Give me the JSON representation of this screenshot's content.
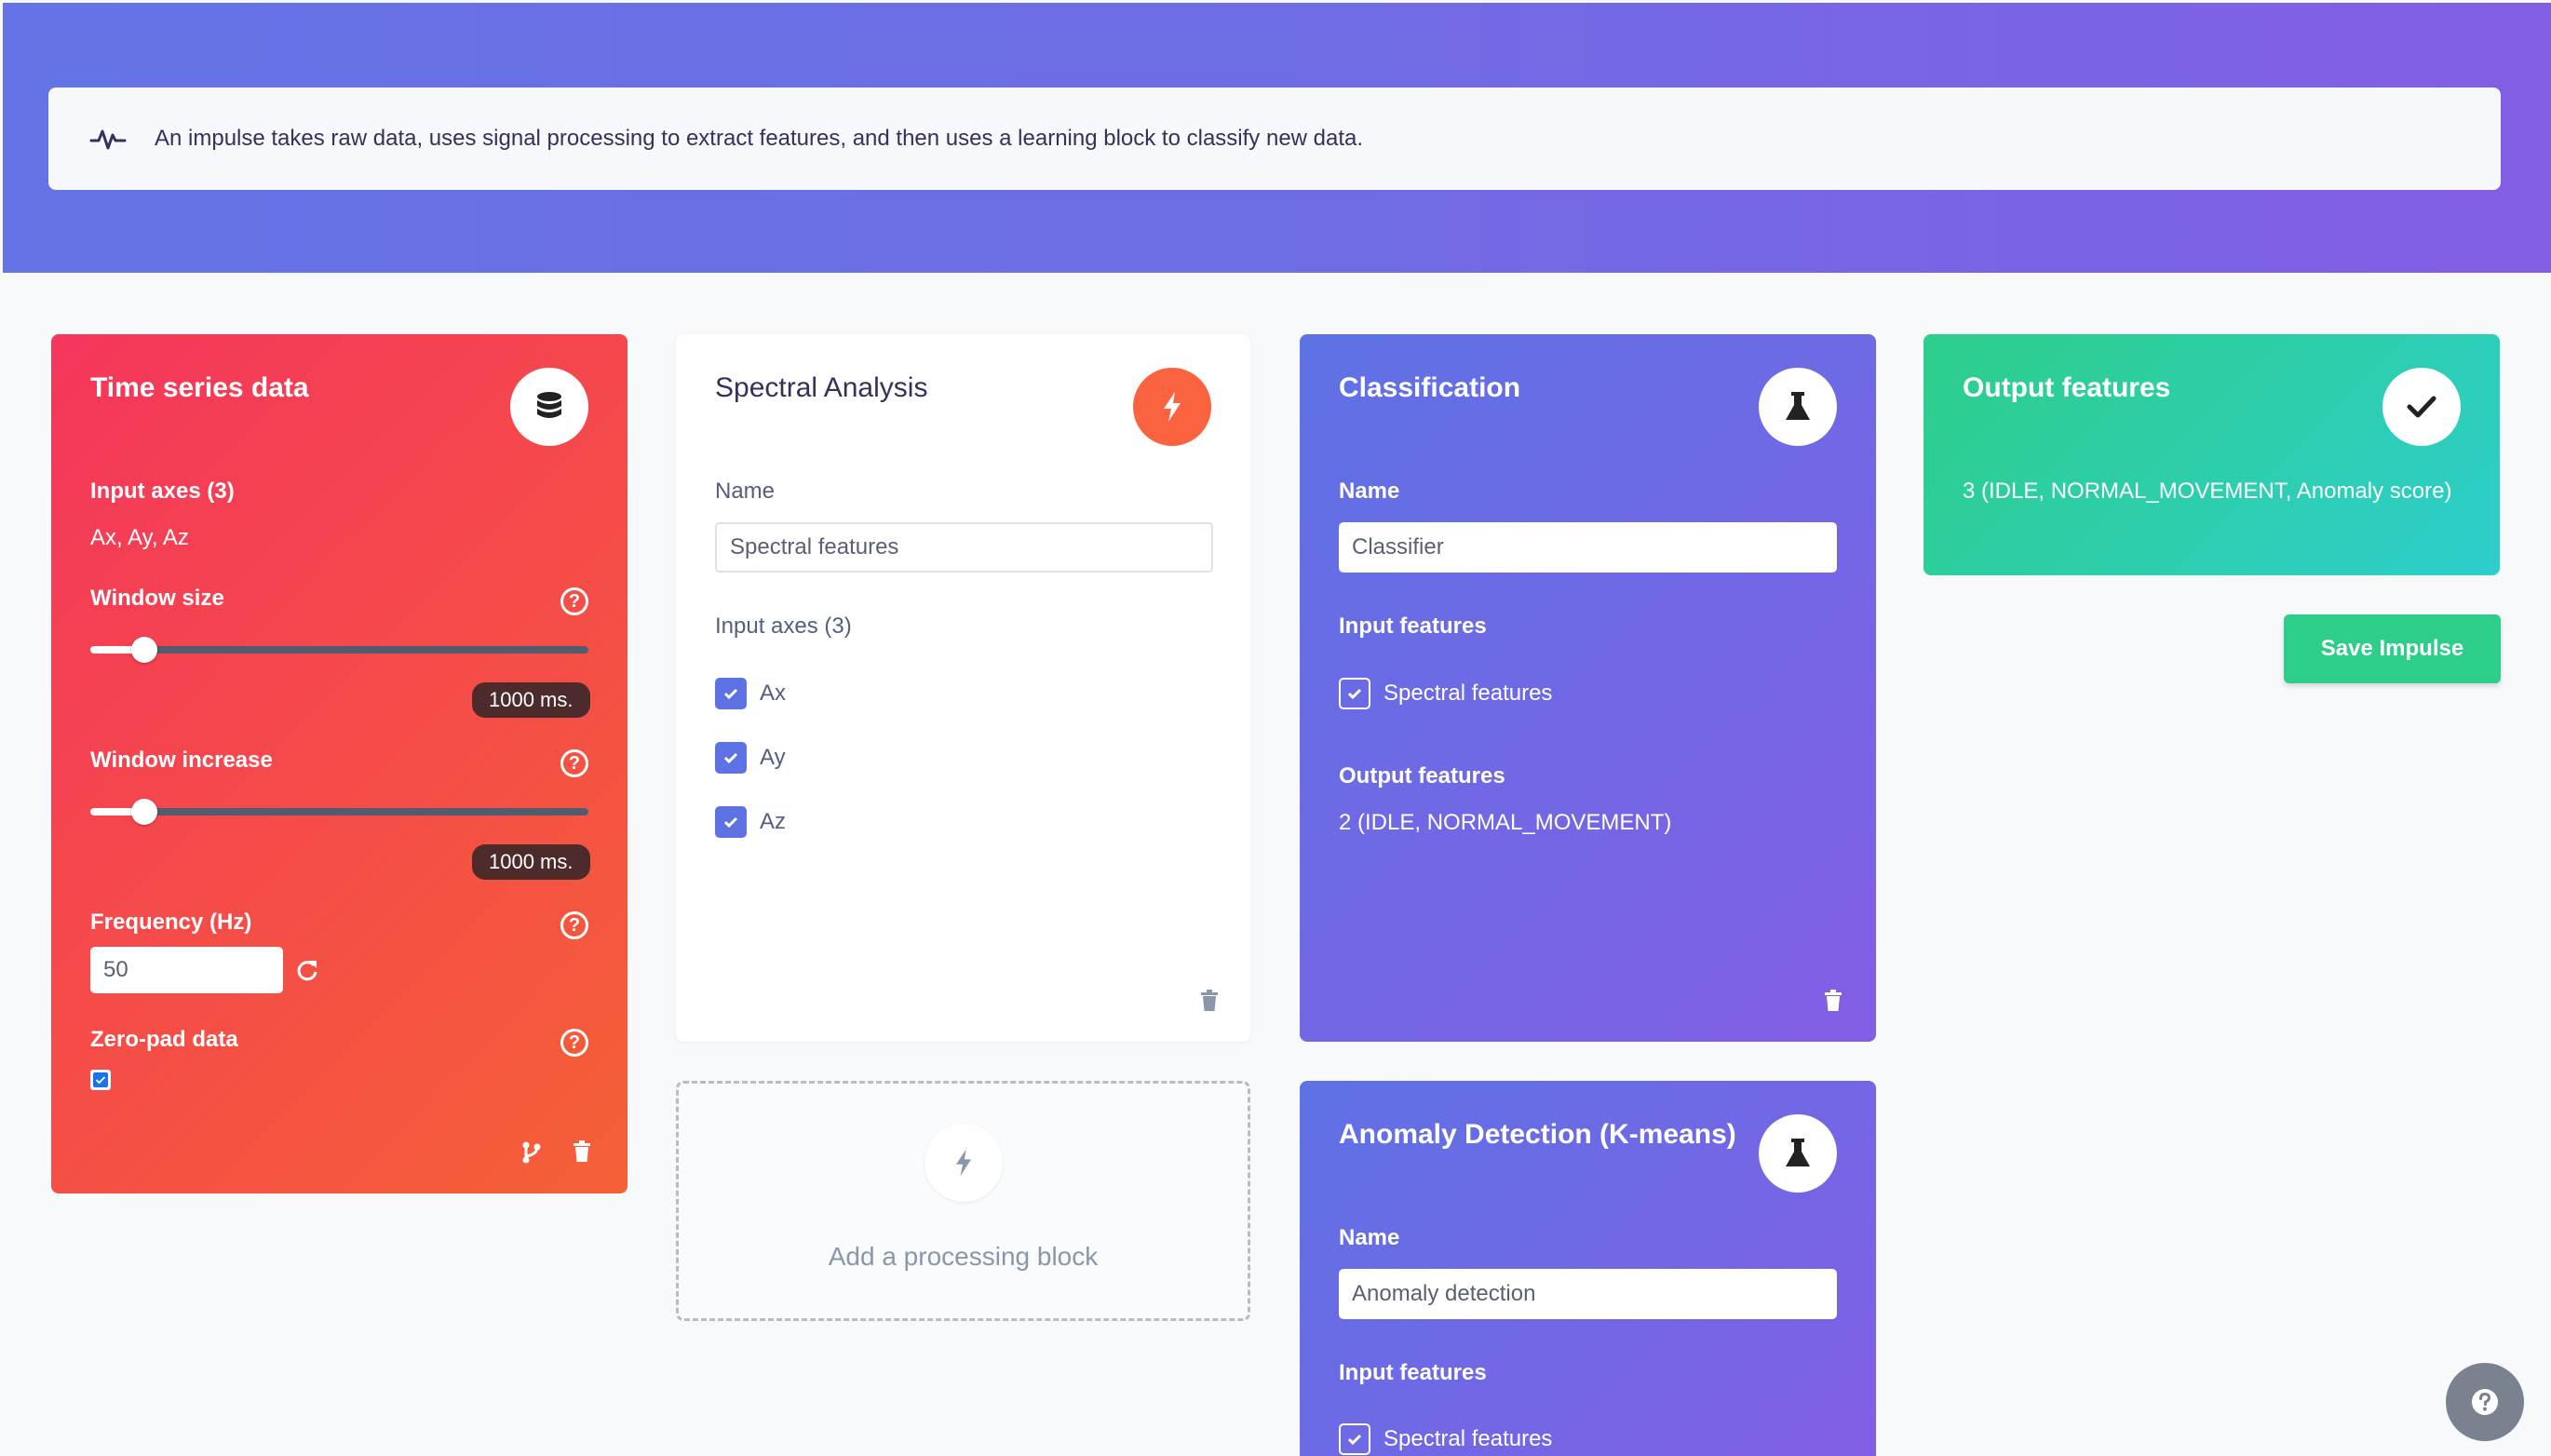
{
  "info": {
    "text": "An impulse takes raw data, uses signal processing to extract features, and then uses a learning block to classify new data.",
    "icon": "pulse-icon"
  },
  "time_series": {
    "title": "Time series data",
    "icon": "database-icon",
    "input_axes_label": "Input axes (3)",
    "input_axes_value": "Ax, Ay, Az",
    "window_size_label": "Window size",
    "window_size_value": "1000 ms.",
    "window_size_level": 0.1,
    "window_increase_label": "Window increase",
    "window_increase_value": "1000 ms.",
    "window_increase_level": 0.1,
    "frequency_label": "Frequency (Hz)",
    "frequency_value": "50",
    "zero_pad_label": "Zero-pad data",
    "zero_pad_checked": true
  },
  "spectral": {
    "title": "Spectral Analysis",
    "icon": "bolt-icon",
    "name_label": "Name",
    "name_value": "Spectral features",
    "input_axes_label": "Input axes (3)",
    "axes": [
      "Ax",
      "Ay",
      "Az"
    ]
  },
  "add_block": {
    "label": "Add a processing block"
  },
  "classification": {
    "title": "Classification",
    "icon": "flask-icon",
    "name_label": "Name",
    "name_value": "Classifier",
    "input_features_label": "Input features",
    "input_feature": "Spectral features",
    "output_features_label": "Output features",
    "output_features_value": "2 (IDLE, NORMAL_MOVEMENT)"
  },
  "anomaly": {
    "title": "Anomaly Detection (K-means)",
    "icon": "flask-icon",
    "name_label": "Name",
    "name_value": "Anomaly detection",
    "input_features_label": "Input features",
    "input_feature": "Spectral features"
  },
  "output": {
    "title": "Output features",
    "icon": "check-icon",
    "value": "3 (IDLE, NORMAL_MOVEMENT, Anomaly score)"
  },
  "actions": {
    "save_label": "Save Impulse"
  },
  "colors": {
    "hero": "#6f6de4",
    "time_series": "#f5365c",
    "classification": "#5e72e4",
    "output": "#2dce89",
    "accent": "#5e72e4"
  }
}
